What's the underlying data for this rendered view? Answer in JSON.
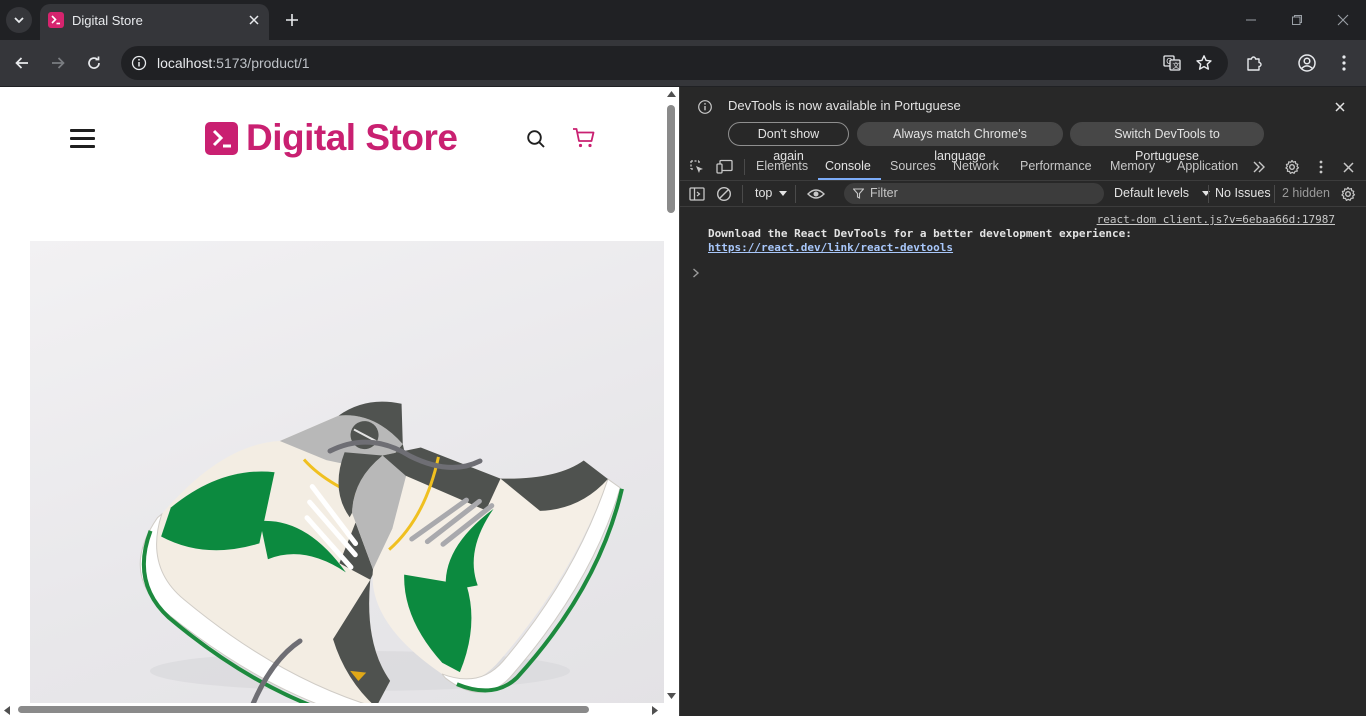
{
  "browser": {
    "tab": {
      "title": "Digital Store"
    },
    "address": {
      "host": "localhost",
      "path": ":5173/product/1"
    }
  },
  "page": {
    "logo": {
      "text": "Digital Store"
    },
    "product_image": {
      "alt": "Green and grey high-top sneakers"
    }
  },
  "devtools": {
    "infobar": {
      "message": "DevTools is now available in Portuguese",
      "buttons": [
        "Don't show again",
        "Always match Chrome's language",
        "Switch DevTools to Portuguese"
      ]
    },
    "tabs": [
      "Elements",
      "Console",
      "Sources",
      "Network",
      "Performance",
      "Memory",
      "Application"
    ],
    "active_tab": "Console",
    "console_bar": {
      "context": "top",
      "filter_placeholder": "Filter",
      "levels": "Default levels",
      "issues": "No Issues",
      "hidden": "2 hidden"
    },
    "log": {
      "source": "react-dom client.js?v=6ebaa66d:17987",
      "message": "Download the React DevTools for a better development experience:",
      "link": "https://react.dev/link/react-devtools"
    }
  },
  "colors": {
    "brand": "#c92071",
    "chrome_dark": "#202124",
    "devtools_bg": "#282828"
  }
}
